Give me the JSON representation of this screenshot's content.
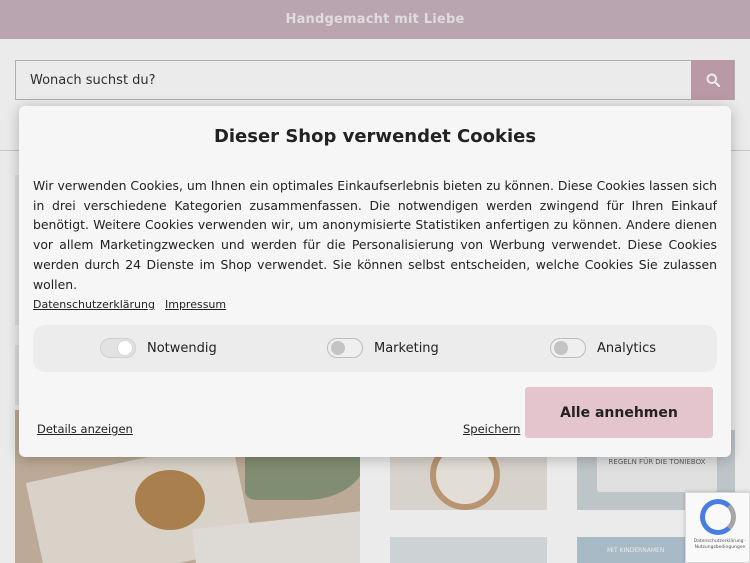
{
  "topbar": {
    "text": "Handgemacht mit Liebe"
  },
  "search": {
    "placeholder": "Wonach suchst du?",
    "button_icon": "search-icon"
  },
  "background_cards": {
    "sign_text": "REGELN FÜR DIE TONIEBOX",
    "small_label": "MIT KINDERNAMEN"
  },
  "cookie_modal": {
    "title": "Dieser Shop verwendet Cookies",
    "body": "Wir verwenden Cookies, um Ihnen ein optimales Einkaufserlebnis bieten zu können. Diese Cookies lassen sich in drei verschiedene Kategorien zusammenfassen. Die notwendigen werden zwingend für Ihren Einkauf benötigt. Weitere Cookies verwenden wir, um anonymisierte Statistiken anfertigen zu können. Andere dienen vor allem Marketingzwecken und werden für die Personalisierung von Werbung verwendet. Diese Cookies werden durch 24 Dienste im Shop verwendet. Sie können selbst entscheiden, welche Cookies Sie zulassen wollen.",
    "links": {
      "privacy": "Datenschutzerklärung",
      "imprint": "Impressum"
    },
    "toggles": [
      {
        "label": "Notwendig",
        "state": "on"
      },
      {
        "label": "Marketing",
        "state": "off"
      },
      {
        "label": "Analytics",
        "state": "off"
      }
    ],
    "details_label": "Details anzeigen",
    "save_label": "Speichern",
    "accept_all_label": "Alle annehmen"
  },
  "recaptcha": {
    "text": "Datenschutzerklärung · Nutzungsbedingungen"
  },
  "colors": {
    "topbar": "#c9b4be",
    "search_button": "#c9a7b3",
    "accept_button": "#e4c5cd",
    "modal_bg": "#f6f6f6"
  }
}
